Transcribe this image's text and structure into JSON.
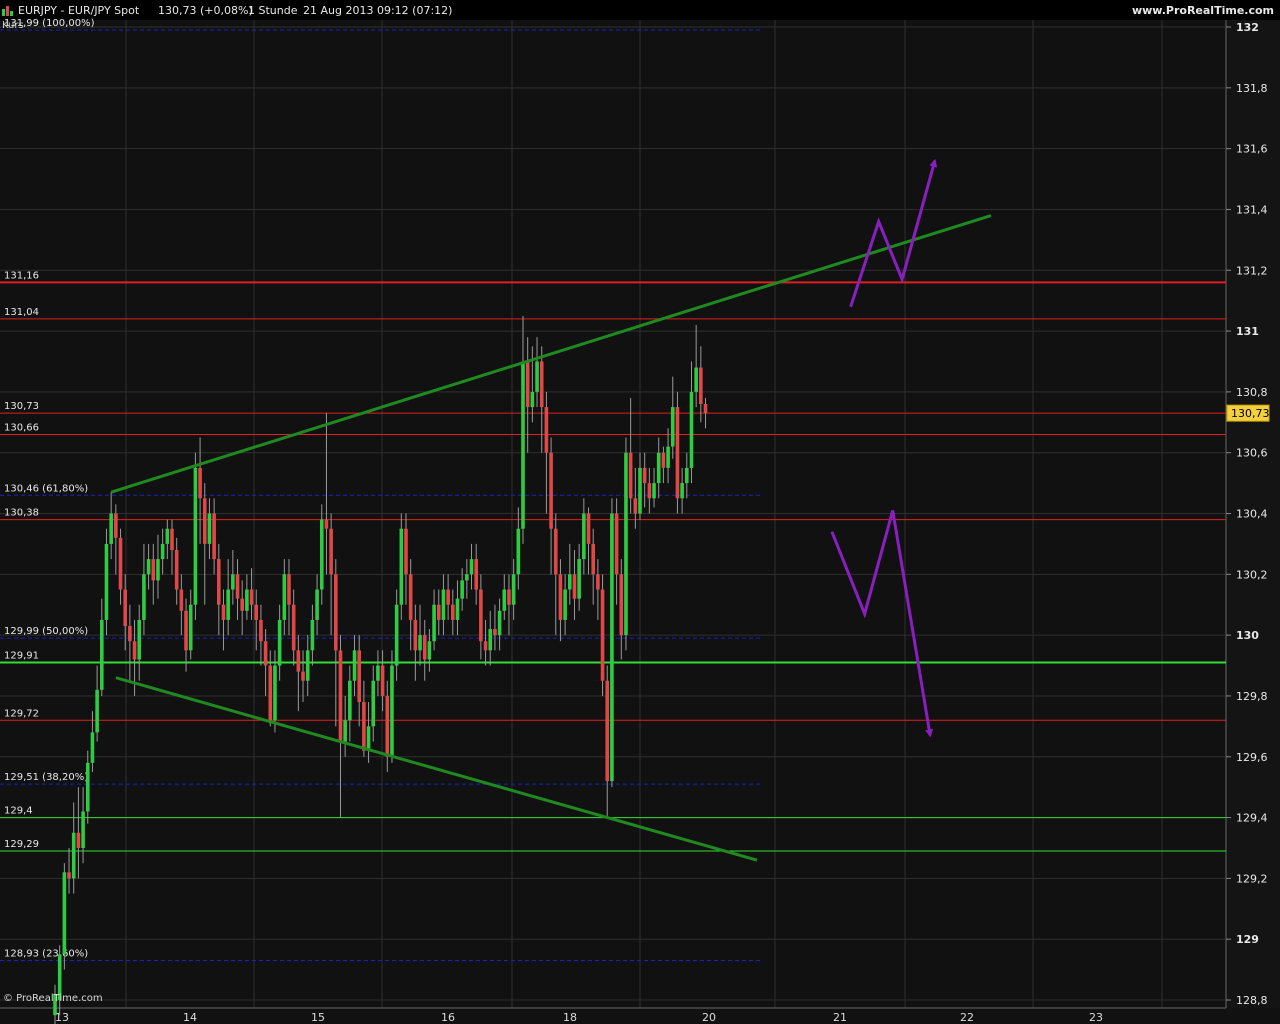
{
  "window": {
    "title": "EURJPY - EUR/JPY Spot",
    "last_price": "130,73 (+0,08%)",
    "timeframe": "1 Stunde",
    "datetime": "21 Aug 2013 09:12 (07:12)",
    "brand": "www.ProRealTime.com",
    "footer_brand": "© ProRealTime.com",
    "indicator_label": "Kurs"
  },
  "colors": {
    "background": "#111111",
    "grid": "#2f2f2f",
    "up_candle": "#2ecc40",
    "down_candle": "#e04848",
    "resistance": "#e02020",
    "support": "#33dd33",
    "fib": "#2020c0",
    "trendline": "#1f8a1f",
    "scenario": "#8a1fc0",
    "price_tag": "#f4d03f"
  },
  "chart_data": {
    "type": "candlestick",
    "symbol": "EURJPY",
    "x_labels": [
      "13",
      "14",
      "15",
      "16",
      "18",
      "20",
      "21",
      "22",
      "23"
    ],
    "y_ticks": [
      "132",
      "131,8",
      "131,6",
      "131,4",
      "131,2",
      "131",
      "130,8",
      "130,6",
      "130,4",
      "130,2",
      "130",
      "129,8",
      "129,6",
      "129,4",
      "129,2",
      "129",
      "128,8"
    ],
    "y_tick_values": [
      132,
      131.8,
      131.6,
      131.4,
      131.2,
      131,
      130.8,
      130.6,
      130.4,
      130.2,
      130,
      129.8,
      129.6,
      129.4,
      129.2,
      129,
      128.8
    ],
    "ylim": [
      128.8,
      132
    ],
    "current_price_tag": "130,73",
    "current_price": 130.73,
    "horizontal_lines": [
      {
        "label": "131,16",
        "value": 131.16,
        "kind": "resistance",
        "thick": true
      },
      {
        "label": "131,04",
        "value": 131.04,
        "kind": "resistance"
      },
      {
        "label": "130,73",
        "value": 130.73,
        "kind": "resistance"
      },
      {
        "label": "130,66",
        "value": 130.66,
        "kind": "resistance"
      },
      {
        "label": "130,38",
        "value": 130.38,
        "kind": "resistance"
      },
      {
        "label": "129,91",
        "value": 129.91,
        "kind": "support",
        "thick": true
      },
      {
        "label": "129,72",
        "value": 129.72,
        "kind": "resistance"
      },
      {
        "label": "129,4",
        "value": 129.4,
        "kind": "support"
      },
      {
        "label": "129,29",
        "value": 129.29,
        "kind": "support"
      },
      {
        "label": "131,99 (100,00%)",
        "value": 131.99,
        "kind": "fib"
      },
      {
        "label": "130,46 (61,80%)",
        "value": 130.46,
        "kind": "fib"
      },
      {
        "label": "129,99 (50,00%)",
        "value": 129.99,
        "kind": "fib"
      },
      {
        "label": "129,51 (38,20%)",
        "value": 129.51,
        "kind": "fib"
      },
      {
        "label": "128,93 (23,60%)",
        "value": 128.93,
        "kind": "fib"
      }
    ],
    "candles": [
      [
        128.75,
        128.82,
        128.7,
        128.85
      ],
      [
        128.8,
        128.95,
        128.75,
        128.98
      ],
      [
        128.95,
        129.22,
        128.9,
        129.25
      ],
      [
        129.22,
        129.2,
        129.15,
        129.3
      ],
      [
        129.2,
        129.35,
        129.15,
        129.45
      ],
      [
        129.35,
        129.3,
        129.2,
        129.5
      ],
      [
        129.3,
        129.42,
        129.25,
        129.5
      ],
      [
        129.42,
        129.58,
        129.38,
        129.62
      ],
      [
        129.58,
        129.68,
        129.55,
        129.75
      ],
      [
        129.68,
        129.82,
        129.65,
        129.9
      ],
      [
        129.82,
        130.05,
        129.8,
        130.12
      ],
      [
        130.05,
        130.3,
        130.0,
        130.35
      ],
      [
        130.3,
        130.4,
        130.25,
        130.47
      ],
      [
        130.4,
        130.32,
        130.2,
        130.43
      ],
      [
        130.32,
        130.15,
        130.1,
        130.35
      ],
      [
        130.15,
        130.03,
        129.95,
        130.2
      ],
      [
        130.03,
        129.98,
        129.85,
        130.1
      ],
      [
        129.98,
        129.92,
        129.8,
        130.05
      ],
      [
        129.92,
        130.05,
        129.85,
        130.1
      ],
      [
        130.05,
        130.2,
        130.0,
        130.3
      ],
      [
        130.2,
        130.25,
        130.15,
        130.3
      ],
      [
        130.25,
        130.18,
        130.1,
        130.3
      ],
      [
        130.18,
        130.25,
        130.12,
        130.33
      ],
      [
        130.25,
        130.3,
        130.2,
        130.35
      ],
      [
        130.3,
        130.35,
        130.25,
        130.38
      ],
      [
        130.35,
        130.28,
        130.2,
        130.38
      ],
      [
        130.28,
        130.15,
        130.1,
        130.32
      ],
      [
        130.15,
        130.08,
        130.0,
        130.2
      ],
      [
        130.08,
        129.95,
        129.88,
        130.12
      ],
      [
        129.95,
        130.1,
        129.92,
        130.15
      ],
      [
        130.1,
        130.55,
        130.05,
        130.6
      ],
      [
        130.55,
        130.45,
        130.3,
        130.65
      ],
      [
        130.45,
        130.3,
        130.1,
        130.5
      ],
      [
        130.3,
        130.4,
        130.25,
        130.45
      ],
      [
        130.4,
        130.25,
        130.2,
        130.45
      ],
      [
        130.25,
        130.1,
        130.0,
        130.3
      ],
      [
        130.1,
        130.05,
        129.95,
        130.15
      ],
      [
        130.05,
        130.15,
        130.0,
        130.25
      ],
      [
        130.15,
        130.2,
        130.1,
        130.28
      ],
      [
        130.2,
        130.12,
        130.05,
        130.25
      ],
      [
        130.12,
        130.08,
        130.0,
        130.18
      ],
      [
        130.08,
        130.15,
        130.05,
        130.2
      ],
      [
        130.15,
        130.1,
        130.05,
        130.22
      ],
      [
        130.1,
        130.05,
        129.95,
        130.15
      ],
      [
        130.05,
        129.98,
        129.9,
        130.1
      ],
      [
        129.98,
        129.9,
        129.8,
        130.02
      ],
      [
        129.9,
        129.72,
        129.7,
        129.95
      ],
      [
        129.72,
        129.9,
        129.68,
        129.95
      ],
      [
        129.9,
        130.05,
        129.85,
        130.1
      ],
      [
        130.05,
        130.2,
        130.0,
        130.25
      ],
      [
        130.2,
        130.1,
        130.0,
        130.25
      ],
      [
        130.1,
        129.95,
        129.9,
        130.15
      ],
      [
        129.95,
        129.88,
        129.75,
        130.0
      ],
      [
        129.88,
        129.85,
        129.78,
        129.95
      ],
      [
        129.85,
        129.95,
        129.8,
        130.0
      ],
      [
        129.95,
        130.05,
        129.9,
        130.1
      ],
      [
        130.05,
        130.15,
        130.0,
        130.2
      ],
      [
        130.15,
        130.38,
        130.1,
        130.43
      ],
      [
        130.38,
        130.35,
        130.2,
        130.73
      ],
      [
        130.35,
        130.2,
        130.0,
        130.4
      ],
      [
        130.2,
        129.95,
        129.7,
        130.25
      ],
      [
        129.95,
        129.65,
        129.4,
        130.0
      ],
      [
        129.65,
        129.72,
        129.6,
        129.8
      ],
      [
        129.72,
        129.85,
        129.65,
        129.9
      ],
      [
        129.85,
        129.95,
        129.8,
        130.0
      ],
      [
        129.95,
        129.78,
        129.7,
        130.0
      ],
      [
        129.78,
        129.62,
        129.6,
        129.85
      ],
      [
        129.62,
        129.7,
        129.58,
        129.78
      ],
      [
        129.7,
        129.85,
        129.65,
        129.9
      ],
      [
        129.85,
        129.9,
        129.8,
        129.95
      ],
      [
        129.9,
        129.8,
        129.75,
        129.95
      ],
      [
        129.8,
        129.6,
        129.55,
        129.85
      ],
      [
        129.6,
        129.9,
        129.58,
        129.95
      ],
      [
        129.9,
        130.1,
        129.85,
        130.15
      ],
      [
        130.1,
        130.35,
        130.05,
        130.4
      ],
      [
        130.35,
        130.2,
        130.1,
        130.4
      ],
      [
        130.2,
        130.05,
        129.95,
        130.25
      ],
      [
        130.05,
        129.95,
        129.85,
        130.1
      ],
      [
        129.95,
        130.0,
        129.9,
        130.1
      ],
      [
        130.0,
        129.92,
        129.85,
        130.05
      ],
      [
        129.92,
        129.98,
        129.88,
        130.02
      ],
      [
        129.98,
        130.1,
        129.95,
        130.15
      ],
      [
        130.1,
        130.05,
        130.0,
        130.15
      ],
      [
        130.05,
        130.15,
        130.0,
        130.2
      ],
      [
        130.15,
        130.1,
        130.05,
        130.2
      ],
      [
        130.1,
        130.05,
        130.0,
        130.15
      ],
      [
        130.05,
        130.12,
        130.0,
        130.18
      ],
      [
        130.12,
        130.18,
        130.08,
        130.22
      ],
      [
        130.18,
        130.2,
        130.12,
        130.25
      ],
      [
        130.2,
        130.25,
        130.15,
        130.3
      ],
      [
        130.25,
        130.15,
        130.1,
        130.3
      ],
      [
        130.15,
        129.98,
        129.92,
        130.2
      ],
      [
        129.98,
        129.95,
        129.9,
        130.05
      ],
      [
        129.95,
        130.02,
        129.9,
        130.08
      ],
      [
        130.02,
        130.0,
        129.95,
        130.1
      ],
      [
        130.0,
        130.08,
        129.95,
        130.12
      ],
      [
        130.08,
        130.15,
        130.05,
        130.2
      ],
      [
        130.15,
        130.1,
        130.0,
        130.2
      ],
      [
        130.1,
        130.2,
        130.05,
        130.25
      ],
      [
        130.2,
        130.35,
        130.15,
        130.42
      ],
      [
        130.35,
        130.9,
        130.3,
        131.05
      ],
      [
        130.9,
        130.75,
        130.6,
        130.98
      ],
      [
        130.75,
        130.8,
        130.7,
        130.95
      ],
      [
        130.8,
        130.9,
        130.75,
        130.98
      ],
      [
        130.9,
        130.75,
        130.6,
        130.95
      ],
      [
        130.75,
        130.6,
        130.4,
        130.8
      ],
      [
        130.6,
        130.35,
        130.2,
        130.65
      ],
      [
        130.35,
        130.2,
        130.0,
        130.4
      ],
      [
        130.2,
        130.05,
        129.98,
        130.25
      ],
      [
        130.05,
        130.15,
        130.0,
        130.2
      ],
      [
        130.15,
        130.2,
        130.1,
        130.3
      ],
      [
        130.2,
        130.12,
        130.05,
        130.28
      ],
      [
        130.12,
        130.25,
        130.08,
        130.3
      ],
      [
        130.25,
        130.4,
        130.2,
        130.45
      ],
      [
        130.4,
        130.3,
        130.2,
        130.42
      ],
      [
        130.3,
        130.2,
        130.1,
        130.35
      ],
      [
        130.2,
        130.15,
        130.05,
        130.25
      ],
      [
        130.15,
        129.85,
        129.8,
        130.2
      ],
      [
        129.85,
        129.52,
        129.4,
        129.9
      ],
      [
        129.52,
        130.4,
        129.5,
        130.45
      ],
      [
        130.4,
        130.2,
        130.1,
        130.45
      ],
      [
        130.2,
        130.0,
        129.92,
        130.25
      ],
      [
        130.0,
        130.6,
        129.95,
        130.65
      ],
      [
        130.6,
        130.45,
        130.4,
        130.78
      ],
      [
        130.45,
        130.4,
        130.35,
        130.55
      ],
      [
        130.4,
        130.55,
        130.38,
        130.6
      ],
      [
        130.55,
        130.5,
        130.42,
        130.6
      ],
      [
        130.5,
        130.45,
        130.4,
        130.55
      ],
      [
        130.45,
        130.5,
        130.42,
        130.55
      ],
      [
        130.5,
        130.6,
        130.45,
        130.65
      ],
      [
        130.6,
        130.55,
        130.5,
        130.62
      ],
      [
        130.55,
        130.62,
        130.5,
        130.68
      ],
      [
        130.62,
        130.75,
        130.58,
        130.85
      ],
      [
        130.75,
        130.45,
        130.4,
        130.8
      ],
      [
        130.45,
        130.5,
        130.4,
        130.55
      ],
      [
        130.5,
        130.55,
        130.45,
        130.6
      ],
      [
        130.55,
        130.8,
        130.5,
        130.9
      ],
      [
        130.8,
        130.88,
        130.75,
        131.02
      ],
      [
        130.88,
        130.76,
        130.7,
        130.95
      ],
      [
        130.76,
        130.73,
        130.68,
        130.78
      ]
    ],
    "trendlines": [
      {
        "name": "upper-channel",
        "from": [
          12,
          130.47
        ],
        "to": [
          200,
          131.38
        ]
      },
      {
        "name": "lower-channel",
        "from": [
          13,
          129.86
        ],
        "to": [
          150,
          129.26
        ]
      }
    ],
    "scenarios": [
      {
        "name": "bullish",
        "points": [
          [
            170,
            131.08
          ],
          [
            176,
            131.36
          ],
          [
            181,
            131.17
          ],
          [
            188,
            131.56
          ]
        ]
      },
      {
        "name": "bearish",
        "points": [
          [
            166,
            130.34
          ],
          [
            173,
            130.07
          ],
          [
            179,
            130.41
          ],
          [
            187,
            129.67
          ]
        ]
      }
    ]
  }
}
